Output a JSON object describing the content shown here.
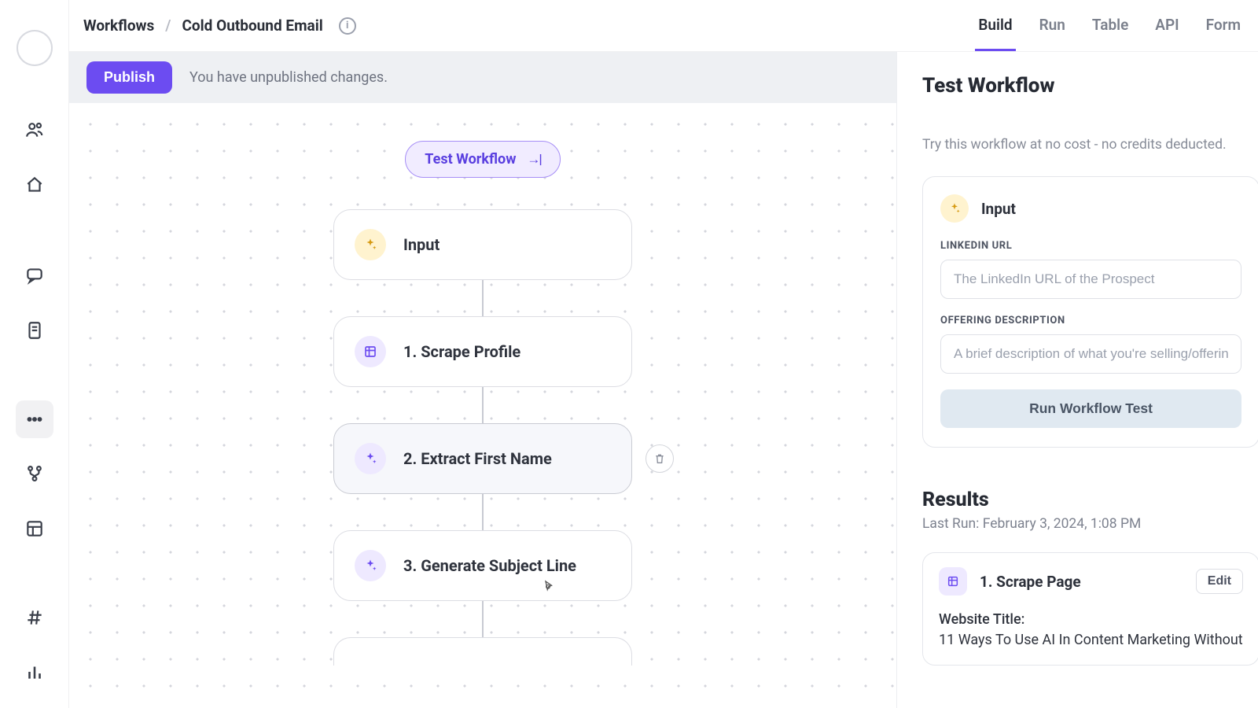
{
  "breadcrumb": {
    "root": "Workflows",
    "current": "Cold Outbound Email"
  },
  "tabs": [
    {
      "label": "Build",
      "active": true
    },
    {
      "label": "Run",
      "active": false
    },
    {
      "label": "Table",
      "active": false
    },
    {
      "label": "API",
      "active": false
    },
    {
      "label": "Form",
      "active": false
    }
  ],
  "publish": {
    "button": "Publish",
    "message": "You have unpublished changes."
  },
  "canvas": {
    "test_pill": "Test Workflow",
    "nodes": [
      {
        "label": "Input",
        "icon": "sparkle-yellow"
      },
      {
        "label": "1. Scrape Profile",
        "icon": "grid-purple"
      },
      {
        "label": "2. Extract First Name",
        "icon": "sparkle-purple",
        "selected": true,
        "deletable": true
      },
      {
        "label": "3. Generate Subject Line",
        "icon": "sparkle-purple"
      }
    ]
  },
  "panel": {
    "title": "Test Workflow",
    "hint": "Try this workflow at no cost - no credits deducted.",
    "input_card": {
      "title": "Input",
      "fields": [
        {
          "label": "LINKEDIN URL",
          "placeholder": "The LinkedIn URL of the Prospect"
        },
        {
          "label": "OFFERING DESCRIPTION",
          "placeholder": "A brief description of what you're selling/offering"
        }
      ],
      "run_button": "Run Workflow Test"
    },
    "results": {
      "title": "Results",
      "last_run": "Last Run: February 3, 2024, 1:08 PM",
      "card": {
        "title": "1. Scrape Page",
        "edit": "Edit",
        "body_label": "Website Title:",
        "body_text": "11 Ways To Use AI In Content Marketing Without"
      }
    }
  }
}
